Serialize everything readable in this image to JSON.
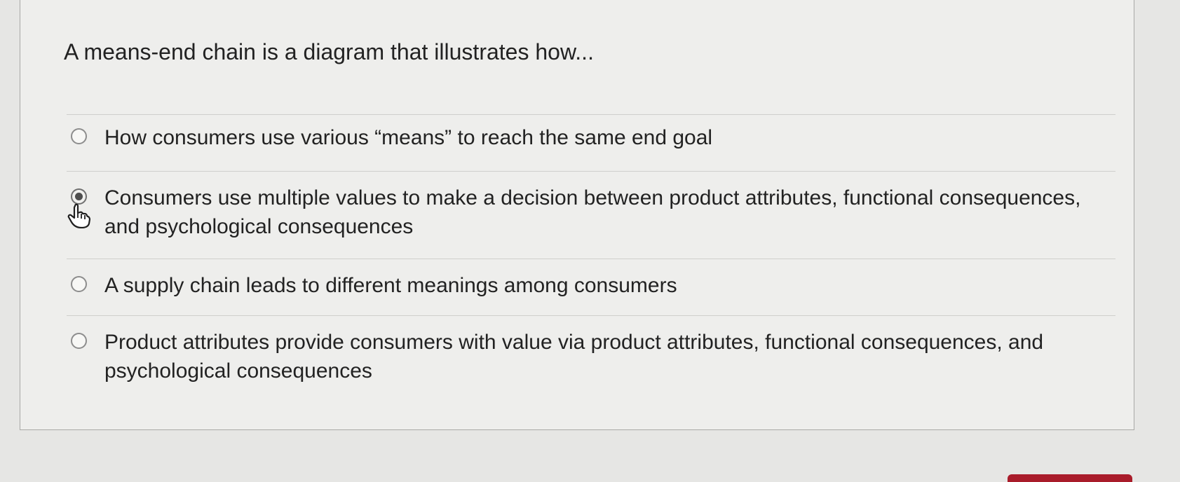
{
  "question": {
    "text": "A means-end chain is a diagram that illustrates how..."
  },
  "answers": [
    {
      "label": "How consumers use various “means” to reach the same end goal",
      "selected": false
    },
    {
      "label": "Consumers use multiple values to make a decision between product attributes, functional consequences, and psychological consequences",
      "selected": true
    },
    {
      "label": "A supply chain leads to different meanings among consumers",
      "selected": false
    },
    {
      "label": "Product attributes provide consumers with value via product attributes, functional consequences, and psychological consequences",
      "selected": false
    }
  ],
  "colors": {
    "footer_button": "#a91c2a"
  }
}
